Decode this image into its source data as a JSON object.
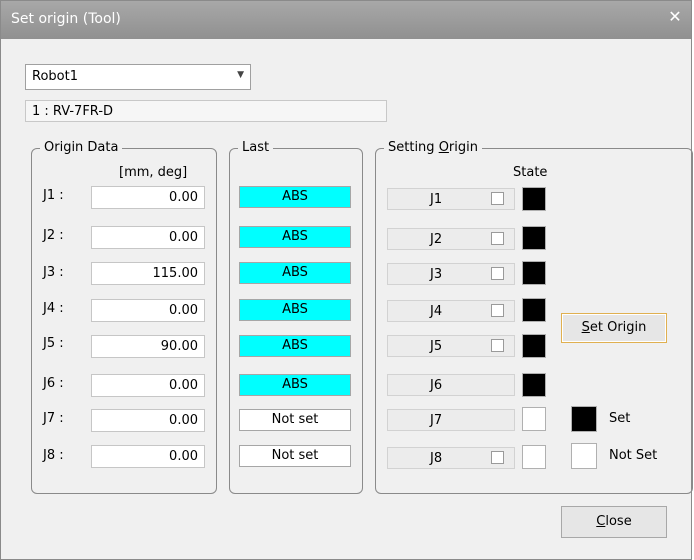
{
  "window": {
    "title": "Set origin (Tool)",
    "close_glyph": "✕"
  },
  "robot_select": {
    "value": "Robot1",
    "dropdown_glyph": "▼"
  },
  "model_label": "1 : RV-7FR-D",
  "origin_data": {
    "legend": "Origin Data",
    "unit": "[mm, deg]",
    "joints": [
      {
        "label": "J1 :",
        "value": "0.00"
      },
      {
        "label": "J2 :",
        "value": "0.00"
      },
      {
        "label": "J3 :",
        "value": "115.00"
      },
      {
        "label": "J4 :",
        "value": "0.00"
      },
      {
        "label": "J5 :",
        "value": "90.00"
      },
      {
        "label": "J6 :",
        "value": "0.00"
      },
      {
        "label": "J7 :",
        "value": "0.00"
      },
      {
        "label": "J8 :",
        "value": "0.00"
      }
    ]
  },
  "last": {
    "legend": "Last",
    "items": [
      "ABS",
      "ABS",
      "ABS",
      "ABS",
      "ABS",
      "ABS",
      "Not set",
      "Not set"
    ],
    "abs_color": "#00ffff"
  },
  "setting_origin": {
    "legend_prefix": "Setting ",
    "legend_mnemonic": "O",
    "legend_suffix": "rigin",
    "state_header": "State",
    "joints": [
      {
        "label": "J1",
        "checked": false,
        "state": "set"
      },
      {
        "label": "J2",
        "checked": false,
        "state": "set"
      },
      {
        "label": "J3",
        "checked": false,
        "state": "set"
      },
      {
        "label": "J4",
        "checked": false,
        "state": "set"
      },
      {
        "label": "J5",
        "checked": false,
        "state": "set"
      },
      {
        "label": "J6",
        "checked": false,
        "state": "set"
      },
      {
        "label": "J7",
        "checked": false,
        "state": "not_set"
      },
      {
        "label": "J8",
        "checked": false,
        "state": "not_set"
      }
    ],
    "set_origin_button": {
      "mnemonic": "S",
      "rest": "et Origin"
    },
    "legend_set": "Set",
    "legend_not_set": "Not Set",
    "set_color": "#000000",
    "not_set_color": "#ffffff"
  },
  "close_button": {
    "mnemonic": "C",
    "rest": "lose"
  }
}
